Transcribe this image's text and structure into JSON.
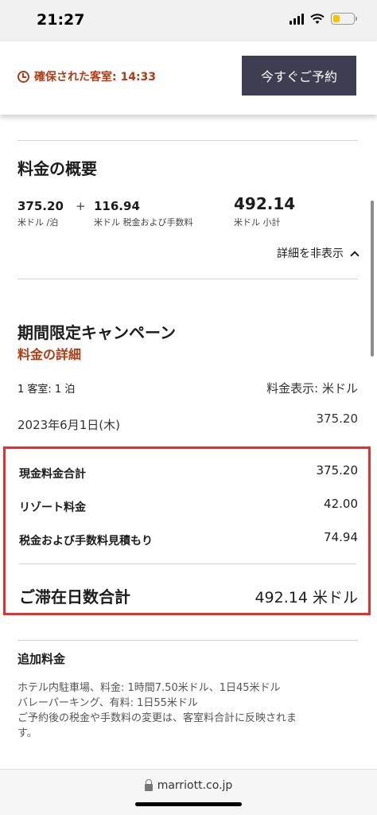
{
  "status_bar": {
    "time": "21:27"
  },
  "header": {
    "hold_text": "確保された客室: 14:33",
    "book_button": "今すぐご予約"
  },
  "summary": {
    "title": "料金の概要",
    "nightly_value": "375.20",
    "nightly_unit": "米ドル /泊",
    "plus": "+",
    "tax_value": "116.94",
    "tax_unit": "米ドル 税金および手数料",
    "subtotal_value": "492.14",
    "subtotal_unit": "米ドル 小計",
    "toggle_label": "詳細を非表示"
  },
  "promo": {
    "title": "期間限定キャンペーン",
    "details_link": "料金の詳細",
    "room_nights": "1 客室: 1 泊",
    "currency_display": "料金表示: 米ドル",
    "date": "2023年6月1日(木)",
    "date_amount": "375.20"
  },
  "breakdown": {
    "rows": [
      {
        "label": "現金料金合計",
        "value": "375.20"
      },
      {
        "label": "リゾート料金",
        "value": "42.00"
      },
      {
        "label": "税金および手数料見積もり",
        "value": "74.94"
      }
    ],
    "total_label": "ご滞在日数合計",
    "total_value": "492.14 米ドル"
  },
  "extra_fees": {
    "title": "追加料金",
    "lines": [
      "ホテル内駐車場、料金: 1時間7.50米ドル、1日45米ドル",
      "バレーパーキング、有料: 1日55米ドル",
      "ご予約後の税金や手数料の変更は、客室料合計に反映されま",
      "す。"
    ]
  },
  "browser": {
    "url": "marriott.co.jp"
  },
  "colors": {
    "accent": "#b13b13",
    "button_bg": "#3f3d51",
    "highlight": "#e33131"
  }
}
